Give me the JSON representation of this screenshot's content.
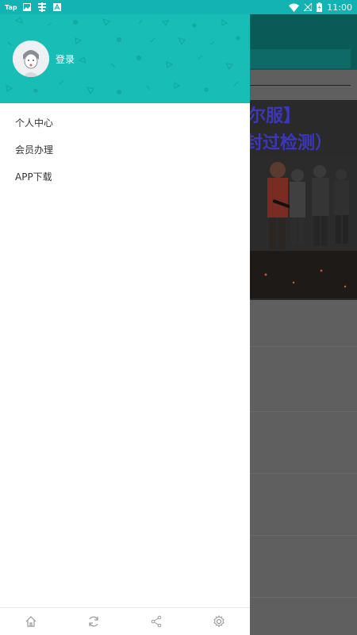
{
  "status_bar": {
    "app_label": "Tap",
    "time": "11:00"
  },
  "background": {
    "banner_line1": "尔服】",
    "banner_line2": "封过检测）"
  },
  "drawer": {
    "login_label": "登录",
    "menu": [
      {
        "label": "个人中心"
      },
      {
        "label": "会员办理"
      },
      {
        "label": "APP下载"
      }
    ],
    "bottom_icons": [
      "home-icon",
      "refresh-icon",
      "share-icon",
      "settings-icon"
    ]
  },
  "colors": {
    "accent": "#18bdb6",
    "status_bar": "#12b3b2",
    "scrim": "#5f5f5f"
  }
}
